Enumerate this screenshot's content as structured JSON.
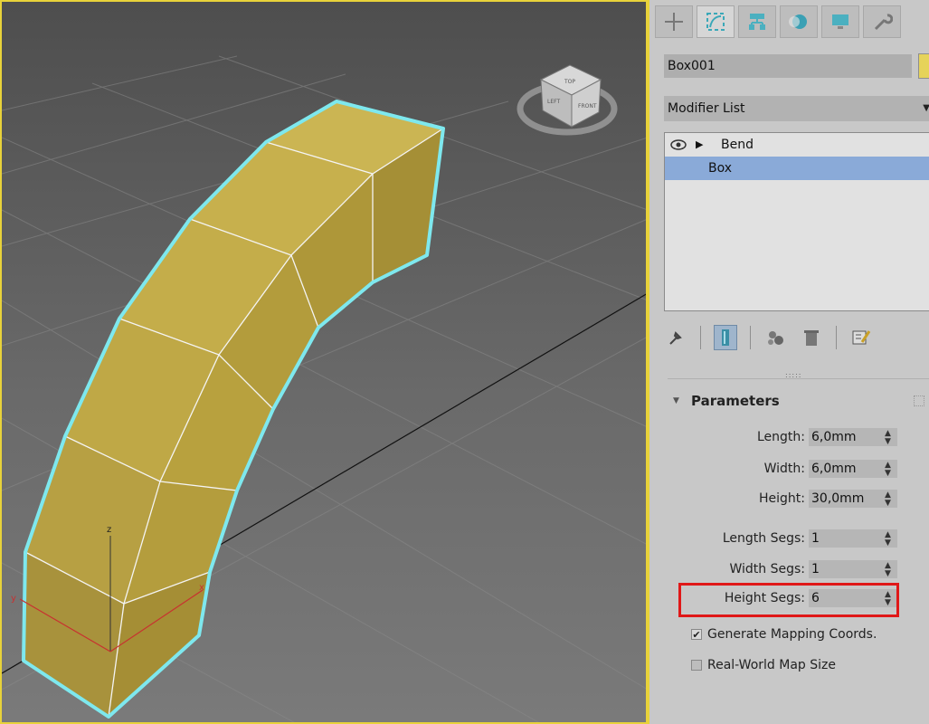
{
  "viewport": {
    "viewcube_labels": [
      "TOP",
      "FRONT",
      "LEFT"
    ],
    "axis_labels": [
      "x",
      "y",
      "z"
    ],
    "object_color": "#c8b24e",
    "selection_color": "#7ee8ee"
  },
  "panel": {
    "tabs": [
      "create-icon",
      "modify-icon",
      "hierarchy-icon",
      "motion-icon",
      "display-icon",
      "utilities-icon"
    ],
    "active_tab": "modify-icon",
    "object_name": "Box001",
    "object_color": "#e6d35a",
    "modifier_list": "Modifier List",
    "stack": [
      {
        "label": "Bend",
        "has_eye": true,
        "has_arrow": true,
        "selected": false
      },
      {
        "label": "Box",
        "has_eye": false,
        "has_arrow": false,
        "selected": true
      }
    ],
    "rollout_title": "Parameters",
    "params": {
      "length_label": "Length:",
      "length_value": "6,0mm",
      "width_label": "Width:",
      "width_value": "6,0mm",
      "height_label": "Height:",
      "height_value": "30,0mm",
      "length_segs_label": "Length Segs:",
      "length_segs_value": "1",
      "width_segs_label": "Width Segs:",
      "width_segs_value": "1",
      "height_segs_label": "Height Segs:",
      "height_segs_value": "6"
    },
    "checks": {
      "gen_mapping": "Generate Mapping Coords.",
      "gen_mapping_checked": true,
      "real_world": "Real-World Map Size",
      "real_world_checked": false
    }
  },
  "annotation": {
    "highlight_color": "#e01818"
  }
}
